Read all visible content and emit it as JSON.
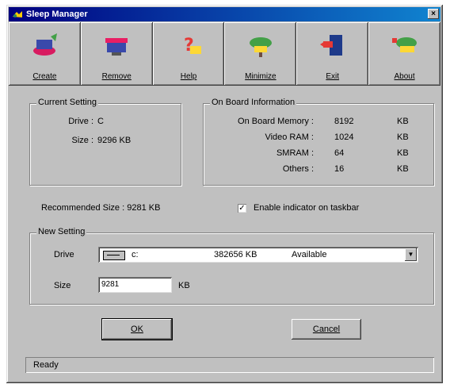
{
  "window": {
    "title": "Sleep Manager",
    "close_glyph": "×"
  },
  "toolbar": [
    {
      "label": "Create",
      "icon": "create-icon"
    },
    {
      "label": "Remove",
      "icon": "remove-icon"
    },
    {
      "label": "Help",
      "icon": "help-icon"
    },
    {
      "label": "Minimize",
      "icon": "minimize-icon"
    },
    {
      "label": "Exit",
      "icon": "exit-icon"
    },
    {
      "label": "About",
      "icon": "about-icon"
    }
  ],
  "current_setting": {
    "title": "Current Setting",
    "drive_label": "Drive :",
    "drive_value": "C",
    "size_label": "Size :",
    "size_value": "9296 KB"
  },
  "onboard": {
    "title": "On Board Information",
    "rows": [
      {
        "label": "On Board Memory :",
        "value": "8192",
        "unit": "KB"
      },
      {
        "label": "Video RAM :",
        "value": "1024",
        "unit": "KB"
      },
      {
        "label": "SMRAM :",
        "value": "64",
        "unit": "KB"
      },
      {
        "label": "Others :",
        "value": "16",
        "unit": "KB"
      }
    ]
  },
  "recommended": "Recommended Size : 9281 KB",
  "taskbar_checkbox": {
    "label": "Enable indicator on taskbar",
    "checked": true,
    "glyph": "✓"
  },
  "new_setting": {
    "title": "New Setting",
    "drive_label": "Drive",
    "drive_letter": "c:",
    "drive_free": "382656 KB",
    "drive_status": "Available",
    "arrow_glyph": "▼",
    "size_label": "Size",
    "size_value": "9281",
    "size_unit": "KB"
  },
  "buttons": {
    "ok": "OK",
    "cancel": "Cancel"
  },
  "status": "Ready"
}
